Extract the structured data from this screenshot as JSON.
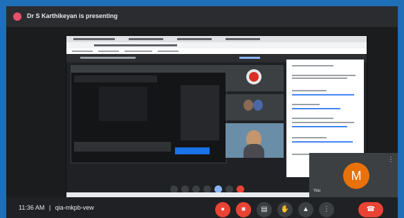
{
  "header": {
    "presenter_initial": "",
    "presenting_text": "Dr S Karthikeyan is presenting"
  },
  "self_view": {
    "avatar_letter": "M",
    "name": "You"
  },
  "footer": {
    "time": "11:36 AM",
    "separator": "|",
    "meeting_code": "qia-mkpb-vew"
  },
  "colors": {
    "frame_border": "#1f6fb8",
    "background": "#202124",
    "end_call": "#ea4335",
    "self_avatar": "#e8710a"
  },
  "icons": {
    "mic": "mic-off-icon",
    "camera": "camera-off-icon",
    "captions": "captions-icon",
    "raise_hand": "raise-hand-icon",
    "present": "present-icon",
    "more": "more-options-icon",
    "end": "end-call-icon"
  }
}
